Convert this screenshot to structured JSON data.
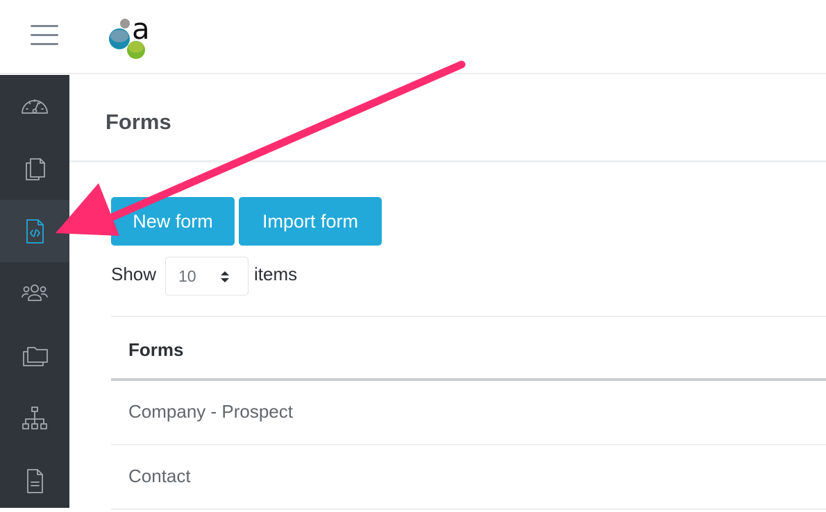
{
  "header": {
    "menu_icon": "hamburger-icon",
    "logo_text": "a"
  },
  "sidebar": {
    "items": [
      {
        "icon": "dashboard-gauge-icon"
      },
      {
        "icon": "documents-copy-icon"
      },
      {
        "icon": "code-file-icon",
        "active": true
      },
      {
        "icon": "users-group-icon"
      },
      {
        "icon": "folders-icon"
      },
      {
        "icon": "sitemap-hierarchy-icon"
      },
      {
        "icon": "document-text-icon"
      }
    ]
  },
  "page": {
    "title": "Forms"
  },
  "toolbar": {
    "new_form_label": "New form",
    "import_form_label": "Import form"
  },
  "pagination": {
    "show_label": "Show",
    "page_size": "10",
    "items_label": "items"
  },
  "table": {
    "columns": [
      "Forms"
    ],
    "rows": [
      "Company - Prospect",
      "Contact"
    ]
  },
  "colors": {
    "accent": "#22a9d9",
    "sidebar": "#30343b",
    "annotation_arrow_color": "#ff2d6f"
  }
}
